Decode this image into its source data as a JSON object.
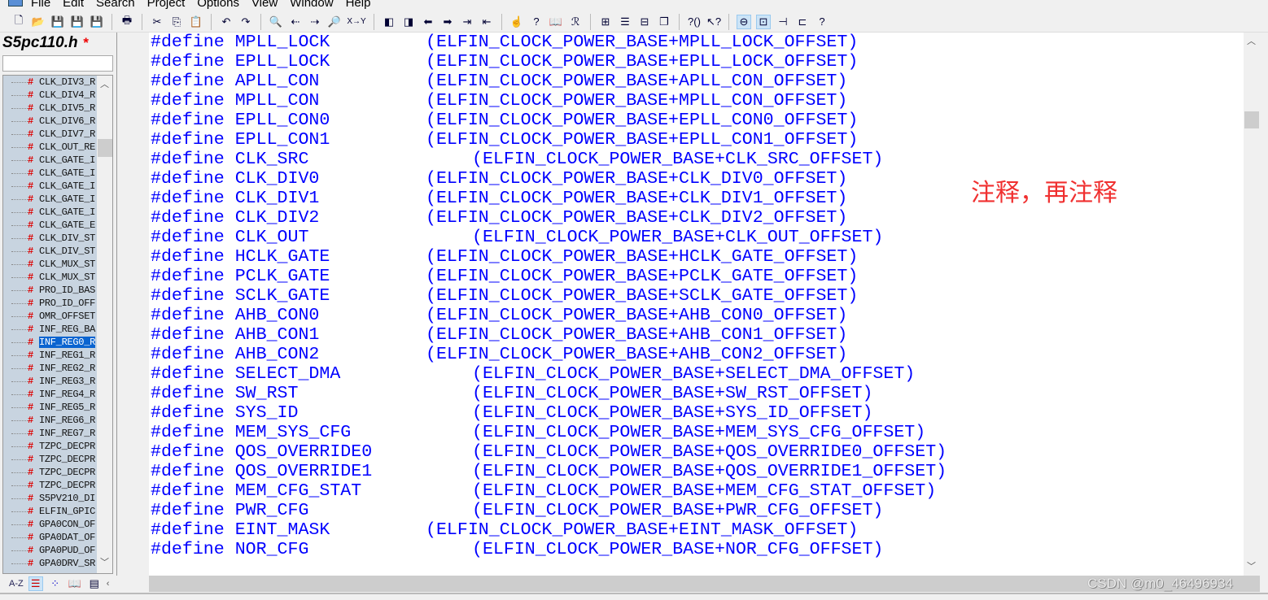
{
  "menu": [
    "File",
    "Edit",
    "Search",
    "Project",
    "Options",
    "View",
    "Window",
    "Help"
  ],
  "toolbar_icons": [
    "new-file",
    "open",
    "save",
    "save-as",
    "save-all",
    "print",
    "cut",
    "copy",
    "paste",
    "undo",
    "redo",
    "find",
    "find-prev",
    "find-next",
    "find-in-files",
    "replace",
    "bookmark-prev",
    "bookmark-next",
    "back",
    "forward",
    "indent",
    "outdent",
    "lookup-reference",
    "help-context",
    "manual",
    "symbol-window",
    "tile",
    "list",
    "split",
    "cascade",
    "help-bracket",
    "whats-this",
    "toggle-1",
    "toggle-2",
    "relation",
    "tree",
    "help"
  ],
  "replace_label": "X→Y",
  "sidebar": {
    "title": "S5pc110.h",
    "modified": "*",
    "search_value": "",
    "items": [
      "CLK_DIV3_R",
      "CLK_DIV4_R",
      "CLK_DIV5_R",
      "CLK_DIV6_R",
      "CLK_DIV7_R",
      "CLK_OUT_RE",
      "CLK_GATE_I",
      "CLK_GATE_I",
      "CLK_GATE_I",
      "CLK_GATE_I",
      "CLK_GATE_I",
      "CLK_GATE_E",
      "CLK_DIV_ST",
      "CLK_DIV_ST",
      "CLK_MUX_ST",
      "CLK_MUX_ST",
      "PRO_ID_BAS",
      "PRO_ID_OFF",
      "OMR_OFFSET",
      "INF_REG_BA",
      "INF_REG0_R",
      "INF_REG1_R",
      "INF_REG2_R",
      "INF_REG3_R",
      "INF_REG4_R",
      "INF_REG5_R",
      "INF_REG6_R",
      "INF_REG7_R",
      "TZPC_DECPR",
      "TZPC_DECPR",
      "TZPC_DECPR",
      "TZPC_DECPR",
      "S5PV210_DI",
      "ELFIN_GPIC",
      "GPA0CON_OF",
      "GPA0DAT_OF",
      "GPA0PUD_OF",
      "GPA0DRV_SR"
    ],
    "selected_index": 20,
    "bottom": {
      "az": "A-Z"
    }
  },
  "code": [
    {
      "kw": "#define",
      "name": "MPLL_LOCK",
      "val": "(ELFIN_CLOCK_POWER_BASE+MPLL_LOCK_OFFSET)",
      "indent": 0
    },
    {
      "kw": "#define",
      "name": "EPLL_LOCK",
      "val": "(ELFIN_CLOCK_POWER_BASE+EPLL_LOCK_OFFSET)",
      "indent": 0
    },
    {
      "kw": "#define",
      "name": "APLL_CON",
      "val": "(ELFIN_CLOCK_POWER_BASE+APLL_CON_OFFSET)",
      "indent": 0
    },
    {
      "kw": "#define",
      "name": "MPLL_CON",
      "val": "(ELFIN_CLOCK_POWER_BASE+MPLL_CON_OFFSET)",
      "indent": 0
    },
    {
      "kw": "#define",
      "name": "EPLL_CON0",
      "val": "(ELFIN_CLOCK_POWER_BASE+EPLL_CON0_OFFSET)",
      "indent": 0
    },
    {
      "kw": "#define",
      "name": "EPLL_CON1",
      "val": "(ELFIN_CLOCK_POWER_BASE+EPLL_CON1_OFFSET)",
      "indent": 0
    },
    {
      "kw": "#define",
      "name": "CLK_SRC",
      "val": "(ELFIN_CLOCK_POWER_BASE+CLK_SRC_OFFSET)",
      "indent": 1
    },
    {
      "kw": "#define",
      "name": "CLK_DIV0",
      "val": "(ELFIN_CLOCK_POWER_BASE+CLK_DIV0_OFFSET)",
      "indent": 0
    },
    {
      "kw": "#define",
      "name": "CLK_DIV1",
      "val": "(ELFIN_CLOCK_POWER_BASE+CLK_DIV1_OFFSET)",
      "indent": 0
    },
    {
      "kw": "#define",
      "name": "CLK_DIV2",
      "val": "(ELFIN_CLOCK_POWER_BASE+CLK_DIV2_OFFSET)",
      "indent": 0
    },
    {
      "kw": "#define",
      "name": "CLK_OUT",
      "val": "(ELFIN_CLOCK_POWER_BASE+CLK_OUT_OFFSET)",
      "indent": 1
    },
    {
      "kw": "#define",
      "name": "HCLK_GATE",
      "val": "(ELFIN_CLOCK_POWER_BASE+HCLK_GATE_OFFSET)",
      "indent": 0
    },
    {
      "kw": "#define",
      "name": "PCLK_GATE",
      "val": "(ELFIN_CLOCK_POWER_BASE+PCLK_GATE_OFFSET)",
      "indent": 0
    },
    {
      "kw": "#define",
      "name": "SCLK_GATE",
      "val": "(ELFIN_CLOCK_POWER_BASE+SCLK_GATE_OFFSET)",
      "indent": 0
    },
    {
      "kw": "#define",
      "name": "AHB_CON0",
      "val": "(ELFIN_CLOCK_POWER_BASE+AHB_CON0_OFFSET)",
      "indent": 0
    },
    {
      "kw": "#define",
      "name": "AHB_CON1",
      "val": "(ELFIN_CLOCK_POWER_BASE+AHB_CON1_OFFSET)",
      "indent": 0
    },
    {
      "kw": "#define",
      "name": "AHB_CON2",
      "val": "(ELFIN_CLOCK_POWER_BASE+AHB_CON2_OFFSET)",
      "indent": 0
    },
    {
      "kw": "#define",
      "name": "SELECT_DMA",
      "val": "(ELFIN_CLOCK_POWER_BASE+SELECT_DMA_OFFSET)",
      "indent": 1
    },
    {
      "kw": "#define",
      "name": "SW_RST",
      "val": "(ELFIN_CLOCK_POWER_BASE+SW_RST_OFFSET)",
      "indent": 1
    },
    {
      "kw": "#define",
      "name": "SYS_ID",
      "val": "(ELFIN_CLOCK_POWER_BASE+SYS_ID_OFFSET)",
      "indent": 1
    },
    {
      "kw": "#define",
      "name": "MEM_SYS_CFG",
      "val": "(ELFIN_CLOCK_POWER_BASE+MEM_SYS_CFG_OFFSET)",
      "indent": 1
    },
    {
      "kw": "#define",
      "name": "QOS_OVERRIDE0",
      "val": "(ELFIN_CLOCK_POWER_BASE+QOS_OVERRIDE0_OFFSET)",
      "indent": 1
    },
    {
      "kw": "#define",
      "name": "QOS_OVERRIDE1",
      "val": "(ELFIN_CLOCK_POWER_BASE+QOS_OVERRIDE1_OFFSET)",
      "indent": 1
    },
    {
      "kw": "#define",
      "name": "MEM_CFG_STAT",
      "val": "(ELFIN_CLOCK_POWER_BASE+MEM_CFG_STAT_OFFSET)",
      "indent": 1
    },
    {
      "kw": "#define",
      "name": "PWR_CFG",
      "val": "(ELFIN_CLOCK_POWER_BASE+PWR_CFG_OFFSET)",
      "indent": 1
    },
    {
      "kw": "#define",
      "name": "EINT_MASK",
      "val": "(ELFIN_CLOCK_POWER_BASE+EINT_MASK_OFFSET)",
      "indent": 0
    },
    {
      "kw": "#define",
      "name": "NOR_CFG",
      "val": "(ELFIN_CLOCK_POWER_BASE+NOR_CFG_OFFSET)",
      "indent": 1
    }
  ],
  "annotation": "注释，再注释",
  "watermark": "CSDN @m0_46496934",
  "colors": {
    "code": "#0000ff",
    "annotation": "#f03030",
    "selection": "#0a64d0",
    "tree_bg": "#c8d4e0"
  }
}
